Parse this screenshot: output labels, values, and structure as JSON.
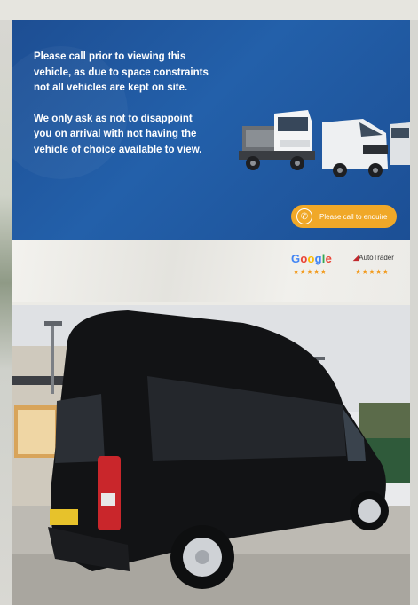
{
  "banner": {
    "paragraph_1": "Please call prior to viewing this vehicle, as due to space constraints not all vehicles are kept on site.",
    "paragraph_2": "We only ask as not to disappoint you on arrival with not having the vehicle of choice available to view.",
    "cta_label": "Please call to enquire",
    "cta_icon": "phone-icon"
  },
  "ratings": {
    "google_label": "Google",
    "google_stars": "★★★★★",
    "autotrader_label": "AutoTrader",
    "autotrader_stars": "★★★★★"
  },
  "colors": {
    "banner_blue": "#2360aa",
    "cta_orange": "#f0a828",
    "star_orange": "#f29b1e"
  }
}
